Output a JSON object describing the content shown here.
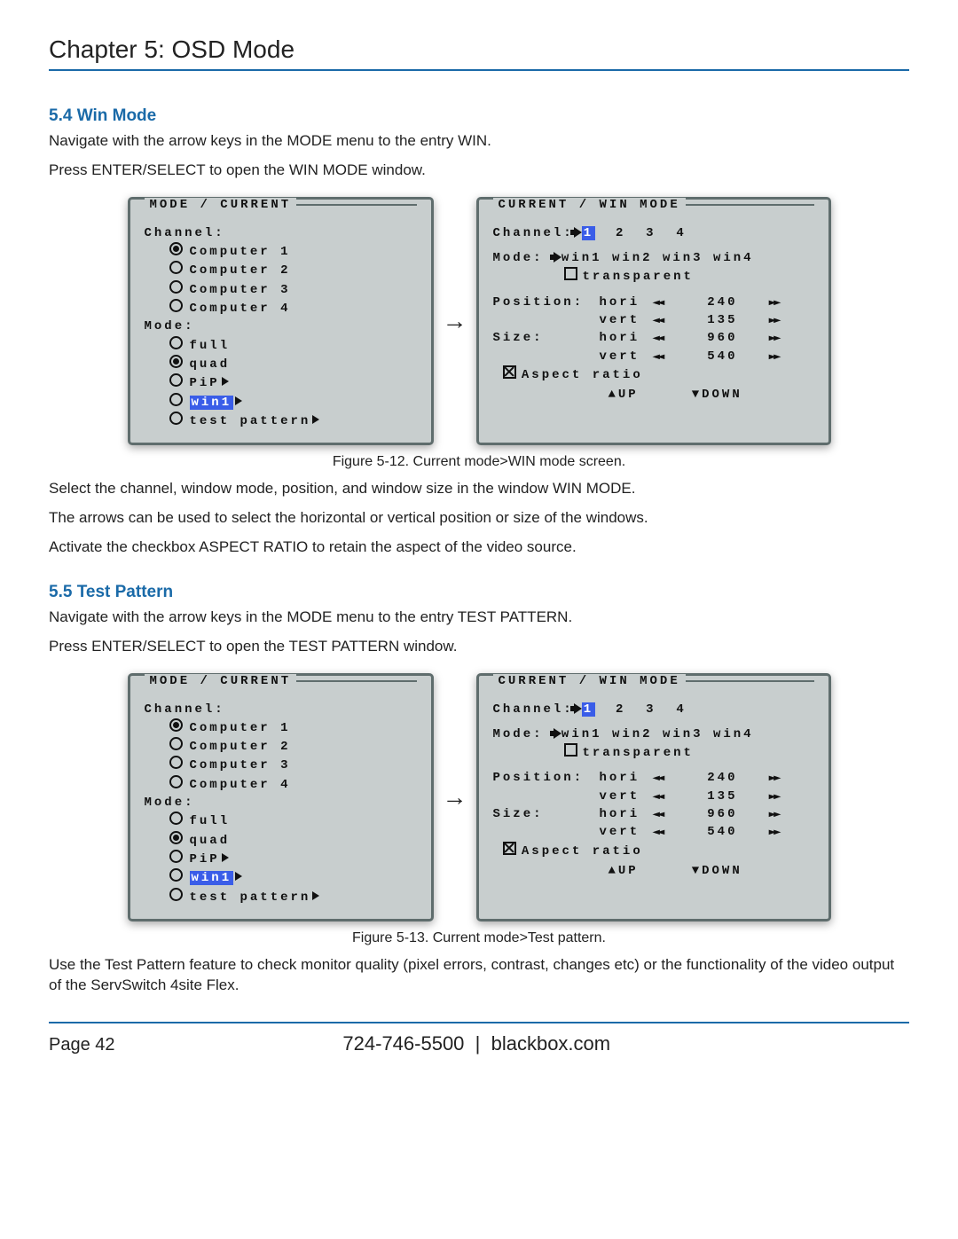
{
  "chapter_title": "Chapter 5: OSD Mode",
  "section_54": {
    "title": "5.4 Win Mode",
    "p1": "Navigate with the arrow keys in the MODE menu to the entry WIN.",
    "p2": "Press ENTER/SELECT to open the WIN MODE window."
  },
  "figure12": {
    "caption": "Figure 5-12. Current mode>WIN mode screen.",
    "left_title": "MODE / CURRENT",
    "right_title": "CURRENT / WIN MODE",
    "channel_label": "Channel:",
    "computers": [
      "Computer 1",
      "Computer 2",
      "Computer 3",
      "Computer 4"
    ],
    "computers_selected": 0,
    "mode_label": "Mode:",
    "modes": [
      "full",
      "quad",
      "PiP",
      "win1",
      "test pattern"
    ],
    "modes_selected": 1,
    "modes_highlight": 3,
    "modes_with_arrow": [
      2,
      3,
      4
    ],
    "channels_right": [
      "1",
      "2",
      "3",
      "4"
    ],
    "channel_selected_right": 0,
    "mode_opts": [
      "win1",
      "win2",
      "win3",
      "win4"
    ],
    "transparent_label": "transparent",
    "position_label": "Position:",
    "size_label": "Size:",
    "rows": [
      {
        "lbl": "Position:",
        "sub": "hori",
        "val": "240"
      },
      {
        "lbl": "",
        "sub": "vert",
        "val": "135"
      },
      {
        "lbl": "Size:",
        "sub": "hori",
        "val": "960"
      },
      {
        "lbl": "",
        "sub": "vert",
        "val": "540"
      }
    ],
    "aspect_label": "Aspect ratio",
    "up_label": "UP",
    "down_label": "DOWN"
  },
  "after_fig12": {
    "p1": "Select the channel, window mode, position, and window size in the window WIN MODE.",
    "p2": "The arrows can be used to select the horizontal or vertical position or size of the windows.",
    "p3": "Activate the checkbox ASPECT RATIO to retain the aspect of the video source."
  },
  "section_55": {
    "title": "5.5 Test Pattern",
    "p1": "Navigate with the arrow keys in the MODE menu to the entry TEST PATTERN.",
    "p2": "Press ENTER/SELECT to open the TEST PATTERN window."
  },
  "figure13": {
    "caption": "Figure 5-13. Current mode>Test pattern."
  },
  "after_fig13": {
    "p1": "Use the Test Pattern feature to check monitor quality (pixel errors, contrast, changes etc) or the functionality of the video output of the ServSwitch 4site Flex."
  },
  "footer": {
    "page": "Page 42",
    "phone": "724-746-5500",
    "site": "blackbox.com"
  }
}
